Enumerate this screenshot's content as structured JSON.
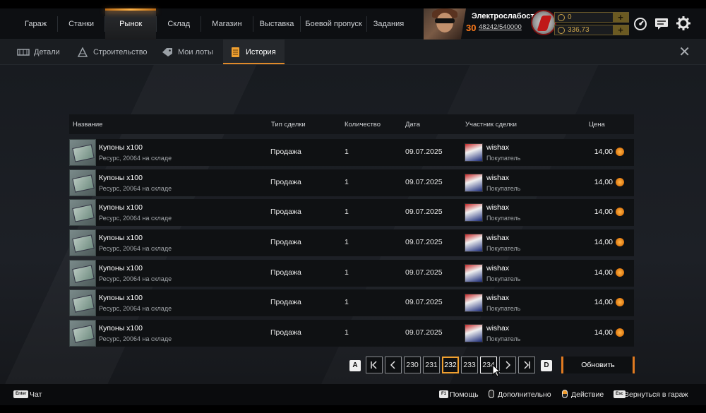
{
  "nav": {
    "items": [
      {
        "label": "Гараж"
      },
      {
        "label": "Станки"
      },
      {
        "label": "Рынок"
      },
      {
        "label": "Склад"
      },
      {
        "label": "Магазин"
      },
      {
        "label": "Выставка"
      },
      {
        "label": "Боевой пропуск"
      },
      {
        "label": "Задания"
      }
    ],
    "active": "Рынок"
  },
  "player": {
    "name": "Электрослабость",
    "level": "30",
    "xp": "48242/540000"
  },
  "currency": {
    "c1": "0",
    "c2": "336,73"
  },
  "subtabs": [
    {
      "label": "Детали"
    },
    {
      "label": "Строительство"
    },
    {
      "label": "Мои лоты"
    },
    {
      "label": "История"
    }
  ],
  "table": {
    "headers": {
      "name": "Название",
      "type": "Тип сделки",
      "qty": "Количество",
      "date": "Дата",
      "participant": "Участник сделки",
      "price": "Цена"
    },
    "rows": [
      {
        "name": "Купоны х100",
        "sub": "Ресурс, 20064 на складе",
        "type": "Продажа",
        "qty": "1",
        "date": "09.07.2025",
        "buyer": "wishax",
        "role": "Покупатель",
        "price": "14,00"
      },
      {
        "name": "Купоны х100",
        "sub": "Ресурс, 20064 на складе",
        "type": "Продажа",
        "qty": "1",
        "date": "09.07.2025",
        "buyer": "wishax",
        "role": "Покупатель",
        "price": "14,00"
      },
      {
        "name": "Купоны х100",
        "sub": "Ресурс, 20064 на складе",
        "type": "Продажа",
        "qty": "1",
        "date": "09.07.2025",
        "buyer": "wishax",
        "role": "Покупатель",
        "price": "14,00"
      },
      {
        "name": "Купоны х100",
        "sub": "Ресурс, 20064 на складе",
        "type": "Продажа",
        "qty": "1",
        "date": "09.07.2025",
        "buyer": "wishax",
        "role": "Покупатель",
        "price": "14,00"
      },
      {
        "name": "Купоны х100",
        "sub": "Ресурс, 20064 на складе",
        "type": "Продажа",
        "qty": "1",
        "date": "09.07.2025",
        "buyer": "wishax",
        "role": "Покупатель",
        "price": "14,00"
      },
      {
        "name": "Купоны х100",
        "sub": "Ресурс, 20064 на складе",
        "type": "Продажа",
        "qty": "1",
        "date": "09.07.2025",
        "buyer": "wishax",
        "role": "Покупатель",
        "price": "14,00"
      },
      {
        "name": "Купоны х100",
        "sub": "Ресурс, 20064 на складе",
        "type": "Продажа",
        "qty": "1",
        "date": "09.07.2025",
        "buyer": "wishax",
        "role": "Покупатель",
        "price": "14,00"
      }
    ]
  },
  "pagination": {
    "key_prev": "A",
    "key_next": "D",
    "pages": [
      "230",
      "231",
      "232",
      "233",
      "234"
    ],
    "current": "232",
    "refresh_label": "Обновить"
  },
  "footer": {
    "chat_key": "Enter",
    "chat": "Чат",
    "help_key": "F1",
    "help": "Помощь",
    "more": "Дополнительно",
    "action": "Действие",
    "back_key": "Esc",
    "back": "Вернуться в гараж"
  },
  "colors": {
    "accent": "#e08a2a",
    "background": "#1a1d21",
    "currency": "#c9a24a"
  }
}
